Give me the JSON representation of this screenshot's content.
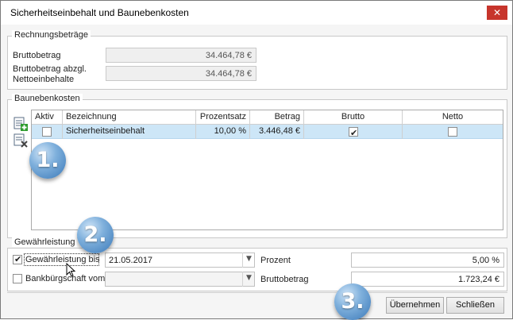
{
  "window": {
    "title": "Sicherheitseinbehalt und Baunebenkosten",
    "close_glyph": "✕"
  },
  "rechnungsbetraege": {
    "legend": "Rechnungsbeträge",
    "bruttobetrag_label": "Bruttobetrag",
    "bruttobetrag_value": "34.464,78 €",
    "bruttobetrag_abzgl_label_line1": "Bruttobetrag abzgl.",
    "bruttobetrag_abzgl_label_line2": "Nettoeinbehalte",
    "bruttobetrag_abzgl_value": "34.464,78 €"
  },
  "baunebenkosten": {
    "legend": "Baunebenkosten",
    "toolbar_icons": [
      "add-row-icon",
      "delete-row-icon"
    ],
    "columns": [
      "Aktiv",
      "Bezeichnung",
      "Prozentsatz",
      "Betrag",
      "Brutto",
      "Netto"
    ],
    "rows": [
      {
        "aktiv": false,
        "bezeichnung": "Sicherheitseinbehalt",
        "prozentsatz": "10,00 %",
        "betrag": "3.446,48 €",
        "brutto": true,
        "netto": false
      }
    ]
  },
  "gewaehrleistung": {
    "legend": "Gewährleistung",
    "checkbox_label": "Gewährleistung bis",
    "checked": true,
    "date_value": "21.05.2017",
    "prozent_label": "Prozent",
    "prozent_value": "5,00 %",
    "bank_label": "Bankbürgschaft vom",
    "bank_checked": false,
    "bank_date_value": "",
    "bruttobetrag_label": "Bruttobetrag",
    "bruttobetrag_value": "1.723,24 €",
    "dropdown_glyph": "▼"
  },
  "buttons": {
    "apply": "Übernehmen",
    "close": "Schließen"
  },
  "badges": {
    "one": "1.",
    "two": "2.",
    "three": "3."
  },
  "colors": {
    "selected_row": "#cde6f7",
    "close_button": "#c7352c",
    "badge_blue": "#3a78b8"
  }
}
